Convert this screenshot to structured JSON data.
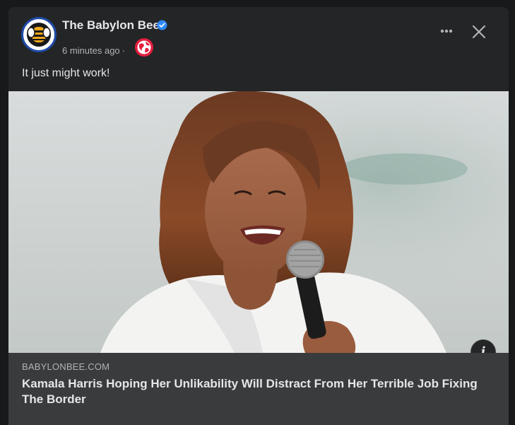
{
  "post": {
    "page_name": "The Babylon Bee",
    "timestamp": "6 minutes ago",
    "meta_separator": "·",
    "text": "It just might work!",
    "audience_icon": "globe-icon",
    "verified_icon": "verified-badge-icon"
  },
  "link_preview": {
    "domain": "BABYLONBEE.COM",
    "headline": "Kamala Harris Hoping Her Unlikability Will Distract From Her Terrible Job Fixing The Border",
    "info_label": "i"
  },
  "colors": {
    "background": "#18191a",
    "card": "#242526",
    "link_box": "#3a3b3c",
    "verified": "#2d88ff",
    "globe": "#e41e3f",
    "avatar_ring": "#1f4aa8",
    "bee_gold": "#f2a71b"
  }
}
